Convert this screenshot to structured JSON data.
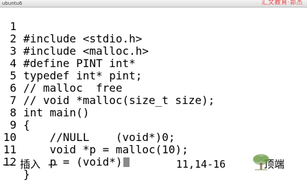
{
  "window": {
    "title": "ubuntu6",
    "watermark": "汇文教育·郭杰"
  },
  "editor": {
    "lines": [
      {
        "num": "1",
        "text": "#include <stdio.h>"
      },
      {
        "num": "2",
        "text": "#include <malloc.h>"
      },
      {
        "num": "3",
        "text": "#define PINT int*"
      },
      {
        "num": "4",
        "text": "typedef int* pint;"
      },
      {
        "num": "5",
        "text": "// malloc  free"
      },
      {
        "num": "6",
        "text": "// void *malloc(size_t size);"
      },
      {
        "num": "7",
        "text": "int main()"
      },
      {
        "num": "8",
        "text": "{"
      },
      {
        "num": "9",
        "text": "    //NULL    (void*)0;"
      },
      {
        "num": "10",
        "text": "    void *p = malloc(10);"
      },
      {
        "num": "11",
        "text": "    p = (void*)"
      },
      {
        "num": "12",
        "text": "}"
      }
    ],
    "empty_marker": "~"
  },
  "statusbar": {
    "mode": "-- 插入 --",
    "position": "11,14-16",
    "scroll": "顶端"
  },
  "colors": {
    "tilde": "#2244cc",
    "cursor": "#8a8a8a",
    "watermark": "#e84040"
  }
}
